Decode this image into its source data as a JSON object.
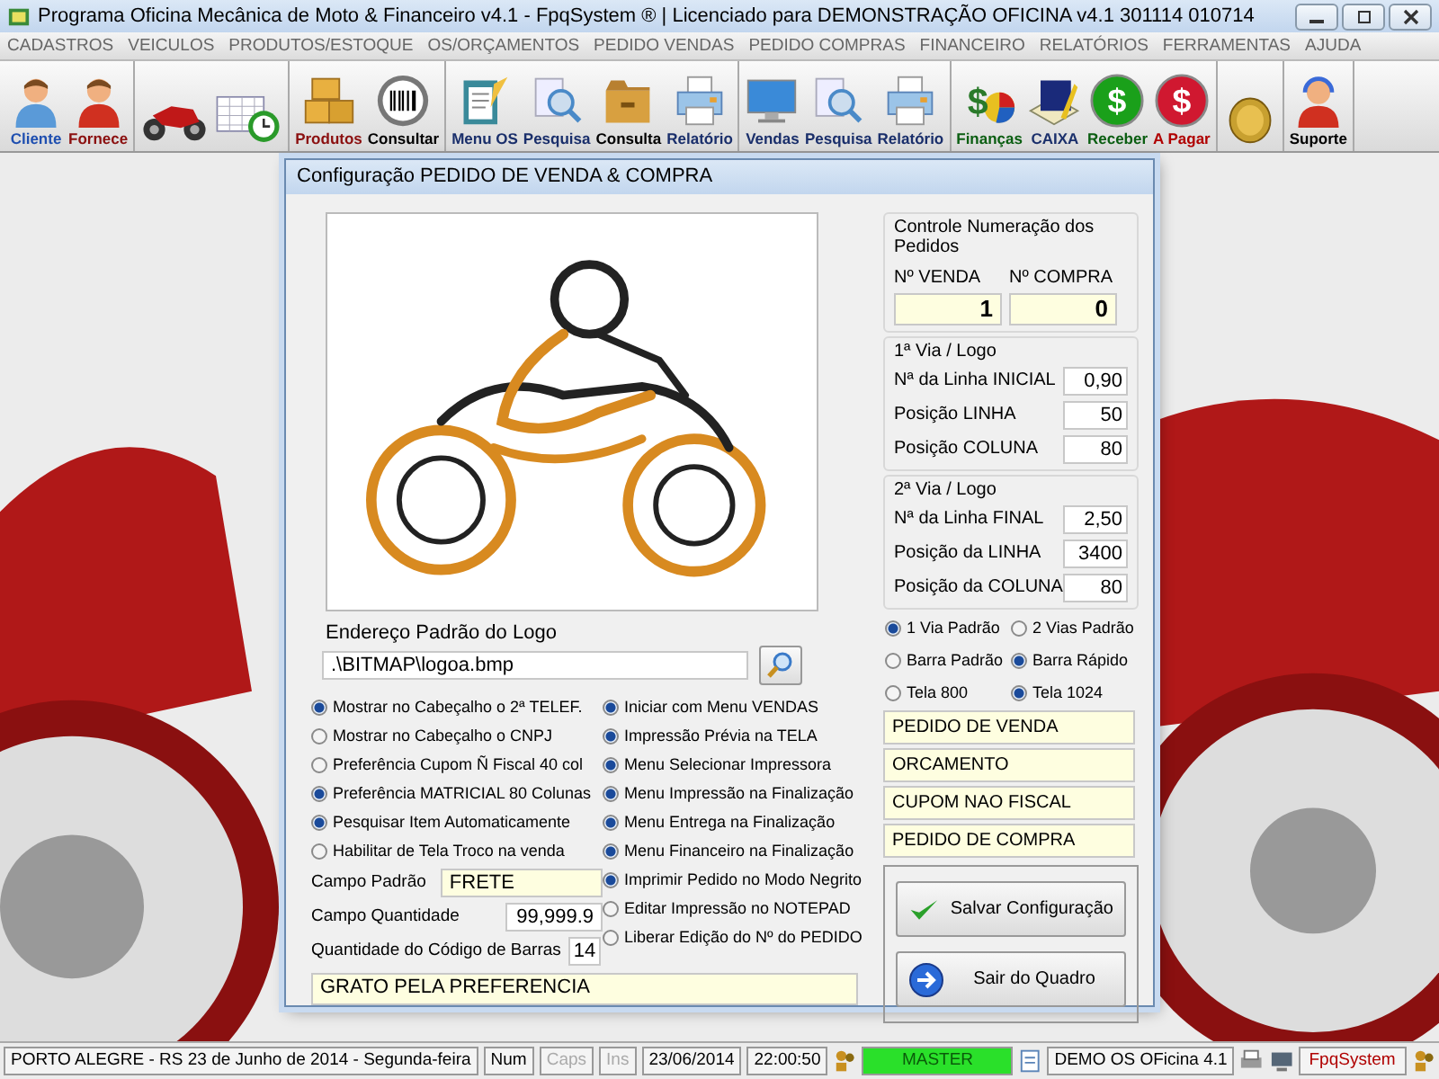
{
  "window": {
    "title": "Programa Oficina Mecânica de Moto & Financeiro v4.1 - FpqSystem ® | Licenciado para  DEMONSTRAÇÃO OFICINA v4.1 301114 010714"
  },
  "menu": [
    "CADASTROS",
    "VEICULOS",
    "PRODUTOS/ESTOQUE",
    "OS/ORÇAMENTOS",
    "PEDIDO VENDAS",
    "PEDIDO COMPRAS",
    "FINANCEIRO",
    "RELATÓRIOS",
    "FERRAMENTAS",
    "AJUDA"
  ],
  "toolbar": {
    "groups": [
      {
        "buttons": [
          {
            "kind": "person",
            "label": "Cliente",
            "color": "#1f4fb0"
          },
          {
            "kind": "person-red",
            "label": "Fornece",
            "color": "#8b1010"
          }
        ]
      },
      {
        "buttons": [
          {
            "kind": "motorcycle"
          },
          {
            "kind": "clock"
          }
        ]
      },
      {
        "buttons": [
          {
            "kind": "boxes",
            "label": "Produtos",
            "color": "#8b1010"
          },
          {
            "kind": "barcode",
            "label": "Consultar",
            "color": "#000000"
          }
        ]
      },
      {
        "buttons": [
          {
            "kind": "clipboard",
            "label": "Menu OS",
            "color": "#1a2f6b"
          },
          {
            "kind": "magnifier",
            "label": "Pesquisa",
            "color": "#1a2f6b"
          },
          {
            "kind": "folder",
            "label": "Consulta",
            "color": "#000000"
          },
          {
            "kind": "printer",
            "label": "Relatório",
            "color": "#1a2f6b"
          }
        ]
      },
      {
        "buttons": [
          {
            "kind": "monitor",
            "label": "Vendas",
            "color": "#1a2f6b"
          },
          {
            "kind": "magnifier",
            "label": "Pesquisa",
            "color": "#1a2f6b"
          },
          {
            "kind": "printer",
            "label": "Relatório",
            "color": "#1a2f6b"
          }
        ]
      },
      {
        "buttons": [
          {
            "kind": "money",
            "symbol": "$",
            "label": "Finanças",
            "color": "#0b5e12"
          },
          {
            "kind": "book",
            "label": "CAIXA",
            "color": "#1a2f6b"
          },
          {
            "kind": "coin-green",
            "symbol": "$",
            "label": "Receber",
            "color": "#0b5e12"
          },
          {
            "kind": "coin-red",
            "symbol": "$",
            "label": "A Pagar",
            "color": "#b00000"
          }
        ]
      },
      {
        "buttons": [
          {
            "kind": "coin-gold"
          }
        ]
      },
      {
        "buttons": [
          {
            "kind": "support",
            "label": "Suporte",
            "color": "#000000"
          }
        ]
      }
    ]
  },
  "dialog": {
    "title": "Configuração PEDIDO DE VENDA & COMPRA",
    "logo_label": "Endereço Padrão do Logo",
    "logo_path": ".\\BITMAP\\logoa.bmp",
    "left_options": [
      {
        "label": "Mostrar no Cabeçalho o 2ª TELEF.",
        "checked": true
      },
      {
        "label": "Mostrar no Cabeçalho o CNPJ",
        "checked": false
      },
      {
        "label": "Preferência Cupom Ñ Fiscal 40 col",
        "checked": false
      },
      {
        "label": "Preferência MATRICIAL 80 Colunas",
        "checked": true
      },
      {
        "label": "Pesquisar Item Automaticamente",
        "checked": true
      },
      {
        "label": "Habilitar de Tela Troco na venda",
        "checked": false
      }
    ],
    "fields": [
      {
        "kind": "wide",
        "label": "Campo Padrão",
        "value": "FRETE"
      },
      {
        "kind": "number",
        "label": "Campo Quantidade",
        "value": "99,999.9"
      },
      {
        "kind": "short",
        "label": "Quantidade do Código de Barras",
        "value": "14"
      }
    ],
    "right_options": [
      {
        "label": "Iniciar com Menu VENDAS",
        "checked": true
      },
      {
        "label": "Impressão Prévia na TELA",
        "checked": true
      },
      {
        "label": "Menu Selecionar Impressora",
        "checked": true
      },
      {
        "label": "Menu Impressão na Finalização",
        "checked": true
      },
      {
        "label": "Menu Entrega na Finalização",
        "checked": true
      },
      {
        "label": "Menu Financeiro na Finalização",
        "checked": true
      },
      {
        "label": "Imprimir Pedido no Modo Negrito",
        "checked": true
      },
      {
        "label": "Editar Impressão no NOTEPAD",
        "checked": false
      },
      {
        "label": "Liberar Edição do Nº do PEDIDO",
        "checked": false
      }
    ],
    "footer_message": "GRATO PELA PREFERENCIA",
    "numbering": {
      "title": "Controle Numeração dos Pedidos",
      "items": [
        {
          "label": "Nº VENDA",
          "value": "1"
        },
        {
          "label": "Nº COMPRA",
          "value": "0"
        }
      ]
    },
    "via_groups": [
      {
        "title": "1ª Via / Logo",
        "rows": [
          {
            "label": "Nª da Linha INICIAL",
            "value": "0,90"
          },
          {
            "label": "Posição LINHA",
            "value": "50"
          },
          {
            "label": "Posição COLUNA",
            "value": "80"
          }
        ]
      },
      {
        "title": "2ª Via / Logo",
        "rows": [
          {
            "label": "Nª da Linha FINAL",
            "value": "2,50"
          },
          {
            "label": "Posição da LINHA",
            "value": "3400"
          },
          {
            "label": "Posição da COLUNA",
            "value": "80"
          }
        ]
      }
    ],
    "mode_options": [
      {
        "options": [
          {
            "label": "1 Via Padrão",
            "checked": true
          },
          {
            "label": "2 Vias Padrão",
            "checked": false
          }
        ]
      },
      {
        "options": [
          {
            "label": "Barra Padrão",
            "checked": false
          },
          {
            "label": "Barra Rápido",
            "checked": true
          }
        ]
      },
      {
        "options": [
          {
            "label": "Tela 800",
            "checked": false
          },
          {
            "label": "Tela 1024",
            "checked": true
          }
        ]
      }
    ],
    "document_titles": [
      "PEDIDO DE VENDA",
      "ORCAMENTO",
      "CUPOM NAO FISCAL",
      "PEDIDO DE COMPRA"
    ],
    "buttons": [
      {
        "kind": "save",
        "label": "Salvar Configuração"
      },
      {
        "kind": "exit",
        "label": "Sair do Quadro"
      }
    ]
  },
  "status_bar": {
    "location": "PORTO ALEGRE - RS 23 de Junho de 2014 - Segunda-feira",
    "indicators": [
      {
        "label": "Num",
        "on": true
      },
      {
        "label": "Caps",
        "on": false
      },
      {
        "label": "Ins",
        "on": false
      }
    ],
    "date": "23/06/2014",
    "time": "22:00:50",
    "user": "MASTER",
    "company": "DEMO OS OFicina 4.1",
    "brand": "FpqSystem"
  }
}
